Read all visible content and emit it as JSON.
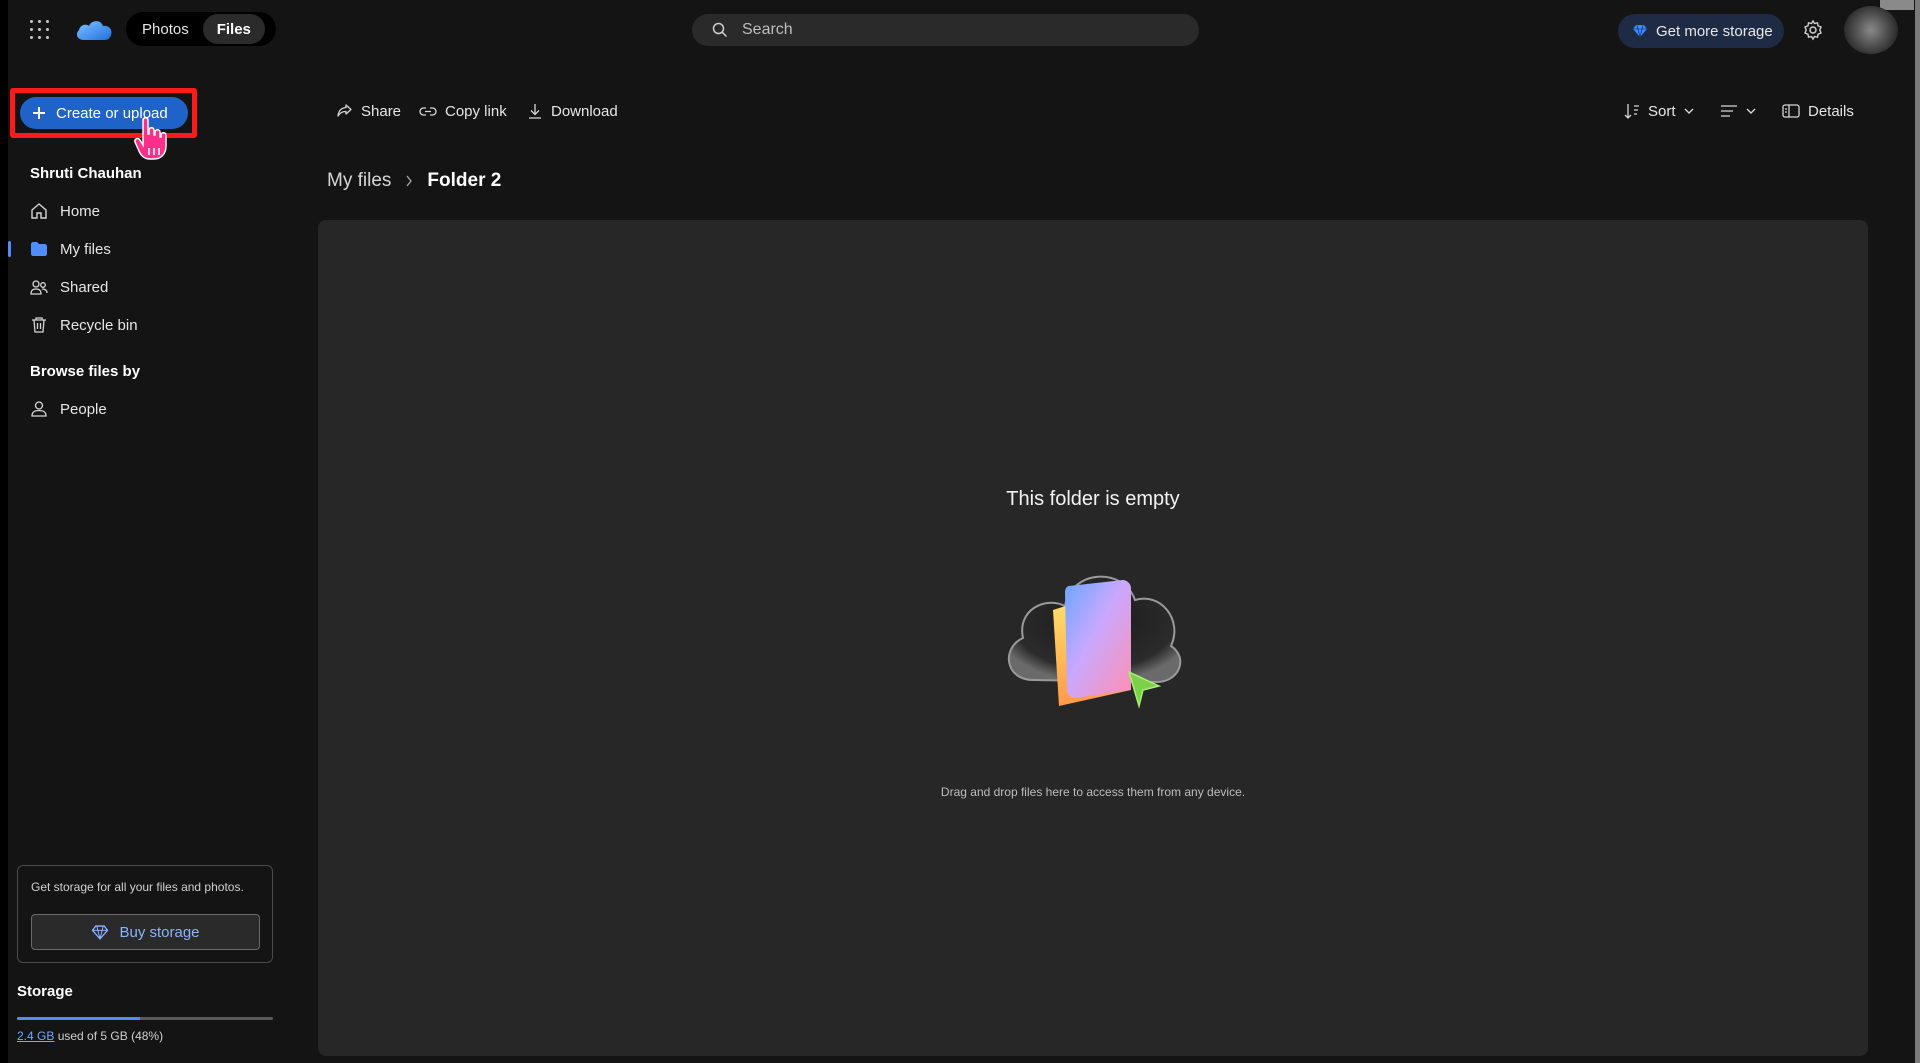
{
  "topbar": {
    "tabs": [
      {
        "label": "Photos",
        "active": false
      },
      {
        "label": "Files",
        "active": true
      }
    ],
    "search_placeholder": "Search",
    "get_storage_label": "Get more storage"
  },
  "sidebar": {
    "create_label": "Create or upload",
    "user_name": "Shruti Chauhan",
    "nav": [
      {
        "label": "Home",
        "icon": "home-icon"
      },
      {
        "label": "My files",
        "icon": "folder-icon",
        "selected": true
      },
      {
        "label": "Shared",
        "icon": "people-icon"
      },
      {
        "label": "Recycle bin",
        "icon": "trash-icon"
      }
    ],
    "browse_title": "Browse files by",
    "browse_items": [
      {
        "label": "People",
        "icon": "person-icon"
      }
    ],
    "storage_card_text": "Get storage for all your files and photos.",
    "buy_label": "Buy storage",
    "storage_title": "Storage",
    "storage_used": "2.4 GB",
    "storage_rest": " used of 5 GB (48%)",
    "storage_fraction": 0.48
  },
  "toolbar": {
    "share": "Share",
    "copy_link": "Copy link",
    "download": "Download",
    "sort": "Sort",
    "details": "Details"
  },
  "breadcrumb": {
    "root": "My files",
    "current": "Folder 2"
  },
  "empty_state": {
    "title": "This folder is empty",
    "description": "Drag and drop files here to access them from any device."
  },
  "colors": {
    "accent": "#1f63c8",
    "highlight": "#ff1a1a",
    "link": "#6fa8ff"
  }
}
